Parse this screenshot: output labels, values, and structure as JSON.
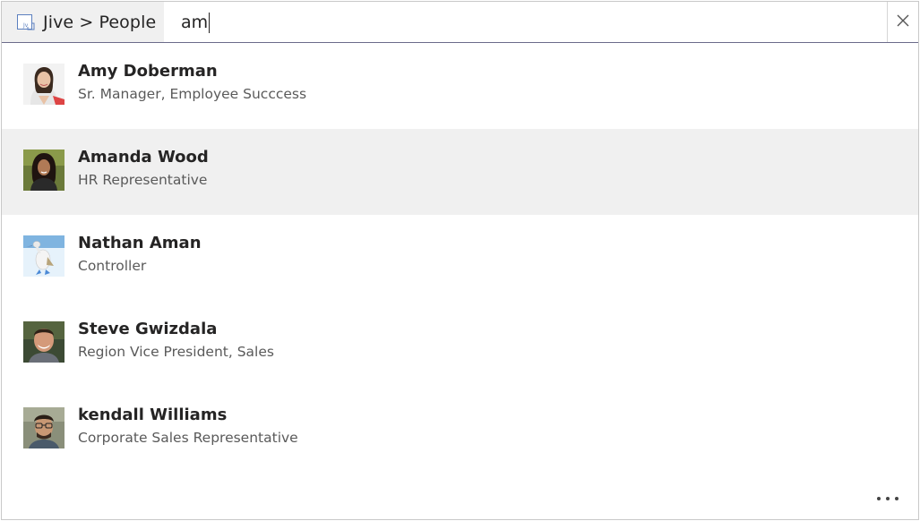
{
  "search": {
    "scope_label": "Jive > People",
    "scope_icon": "jive-app-icon",
    "query": "am",
    "clear_icon": "close-icon"
  },
  "results": [
    {
      "name": "Amy Doberman",
      "title": "Sr. Manager, Employee Succcess",
      "selected": false,
      "avatar": "woman-light-hair-photo"
    },
    {
      "name": "Amanda Wood",
      "title": "HR Representative",
      "selected": true,
      "avatar": "woman-dark-hair-photo"
    },
    {
      "name": "Nathan Aman",
      "title": "Controller",
      "selected": false,
      "avatar": "bird-photo"
    },
    {
      "name": "Steve Gwizdala",
      "title": "Region Vice President, Sales",
      "selected": false,
      "avatar": "man-smiling-photo"
    },
    {
      "name": "kendall Williams",
      "title": "Corporate Sales Representative",
      "selected": false,
      "avatar": "man-glasses-photo"
    }
  ],
  "footer": {
    "more_icon": "more-ellipsis-icon"
  },
  "colors": {
    "selected_row": "#f0f0f0",
    "header_divider": "#6b6b8a",
    "text": "#252424",
    "subtext": "#5a5a5a"
  }
}
